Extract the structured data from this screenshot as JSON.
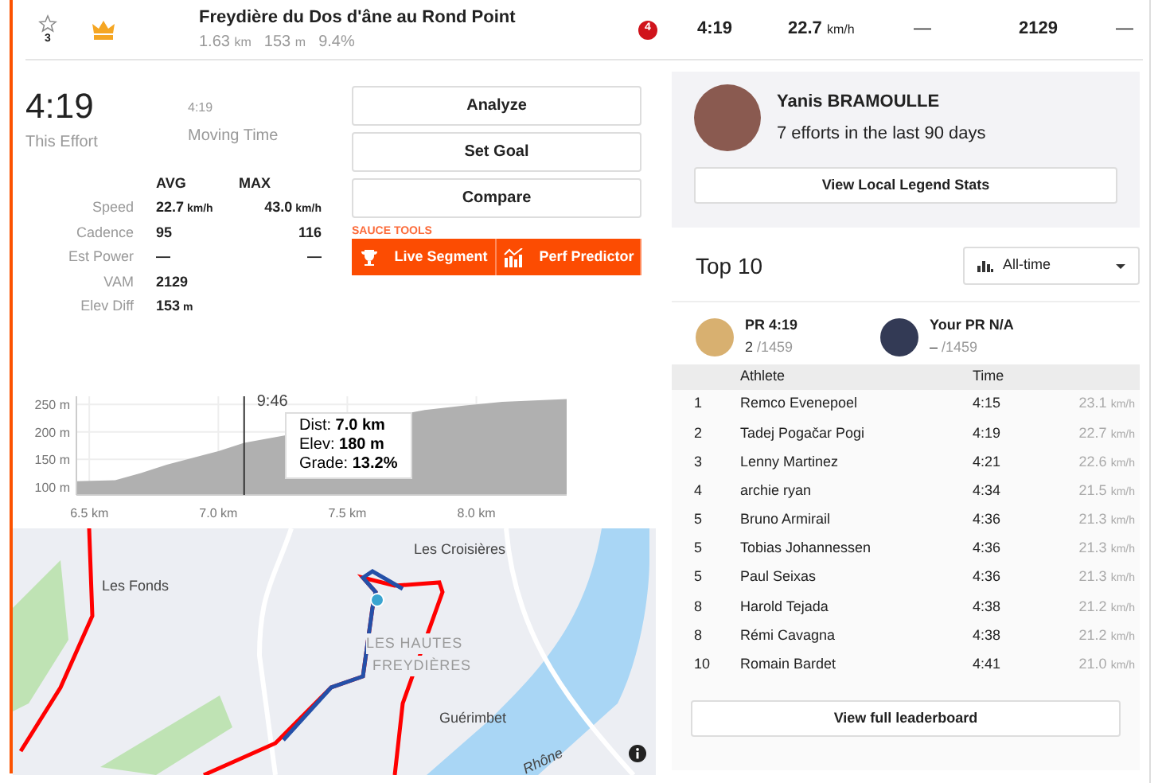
{
  "segment": {
    "star_count": "3",
    "name": "Freydière du Dos d'âne au Rond Point",
    "distance": "1.63",
    "distance_unit": "km",
    "elevation": "153",
    "elevation_unit": "m",
    "grade": "9.4%",
    "badge": "4",
    "time": "4:19",
    "speed": "22.7",
    "speed_unit": "km/h",
    "power": "—",
    "vam": "2129",
    "last": "—"
  },
  "effort": {
    "time": "4:19",
    "time_label": "This Effort",
    "moving_time": "4:19",
    "moving_label": "Moving Time"
  },
  "stats": {
    "columns": [
      "AVG",
      "MAX"
    ],
    "rows": [
      {
        "label": "Speed",
        "avg": "22.7",
        "avg_unit": "km/h",
        "max": "43.0",
        "max_unit": "km/h"
      },
      {
        "label": "Cadence",
        "avg": "95",
        "max": "116"
      },
      {
        "label": "Est Power",
        "avg": "—",
        "max": "—"
      },
      {
        "label": "VAM",
        "avg": "2129"
      },
      {
        "label": "Elev Diff",
        "avg": "153",
        "avg_unit": "m"
      }
    ]
  },
  "actions": [
    "Analyze",
    "Set Goal",
    "Compare"
  ],
  "sauce_tools": {
    "title": "SAUCE TOOLS",
    "buttons": [
      {
        "label": "Live Segment",
        "kind": "trophy"
      },
      {
        "label": "Perf Predictor",
        "kind": "chart"
      }
    ]
  },
  "elevation": {
    "chart_data": {
      "type": "area",
      "grid": true,
      "x": [
        6.45,
        6.6,
        6.7,
        6.8,
        7.0,
        7.1,
        7.8,
        7.95,
        8.1,
        8.35
      ],
      "series": [
        {
          "color": "#b0b0b0",
          "values": [
            110,
            112,
            125,
            140,
            165,
            180,
            240,
            248,
            255,
            260
          ]
        }
      ],
      "ref_lines": [
        {
          "axis": "x",
          "value": 7.1
        }
      ],
      "xlim": [
        6.45,
        8.35
      ],
      "ylim": [
        85,
        265
      ],
      "xticks": [
        {
          "value": 6.5,
          "label": "6.5 km"
        },
        {
          "value": 7.0,
          "label": "7.0 km"
        },
        {
          "value": 7.5,
          "label": "7.5 km"
        },
        {
          "value": 8.0,
          "label": "8.0 km"
        }
      ],
      "yticks": [
        {
          "value": 100,
          "label": "100 m"
        },
        {
          "value": 150,
          "label": "150 m"
        },
        {
          "value": 200,
          "label": "200 m"
        },
        {
          "value": 250,
          "label": "250 m"
        }
      ]
    },
    "cursor_time": "9:46",
    "tooltip": [
      {
        "label": "Dist:",
        "value": "7.0 km"
      },
      {
        "label": "Elev:",
        "value": "180 m"
      },
      {
        "label": "Grade:",
        "value": "13.2%"
      }
    ]
  },
  "map": {
    "labels": [
      "Les Fonds",
      "Les Croisières",
      "LES HAUTES",
      "FREYDIÈRES",
      "Guérimbet",
      "Rhône"
    ]
  },
  "local_legend": {
    "name": "Yanis BRAMOULLE",
    "efforts": "7 efforts in the last 90 days",
    "button": "View Local Legend Stats"
  },
  "leaderboard": {
    "title": "Top 10",
    "filter": "All-time",
    "prs": [
      {
        "label": "PR 4:19",
        "rank": "2",
        "total": "/1459"
      },
      {
        "label": "Your PR N/A",
        "rank": "–",
        "total": "/1459"
      }
    ],
    "columns": [
      "Athlete",
      "Time"
    ],
    "rows": [
      {
        "rank": "1",
        "name": "Remco Evenepoel",
        "time": "4:15",
        "speed": "23.1",
        "unit": "km/h"
      },
      {
        "rank": "2",
        "name": "Tadej Pogačar Pogi",
        "time": "4:19",
        "speed": "22.7",
        "unit": "km/h"
      },
      {
        "rank": "3",
        "name": "Lenny Martinez",
        "time": "4:21",
        "speed": "22.6",
        "unit": "km/h"
      },
      {
        "rank": "4",
        "name": "archie ryan",
        "time": "4:34",
        "speed": "21.5",
        "unit": "km/h"
      },
      {
        "rank": "5",
        "name": "Bruno Armirail",
        "time": "4:36",
        "speed": "21.3",
        "unit": "km/h"
      },
      {
        "rank": "5",
        "name": "Tobias Johannessen",
        "time": "4:36",
        "speed": "21.3",
        "unit": "km/h"
      },
      {
        "rank": "5",
        "name": "Paul Seixas",
        "time": "4:36",
        "speed": "21.3",
        "unit": "km/h"
      },
      {
        "rank": "8",
        "name": "Harold Tejada",
        "time": "4:38",
        "speed": "21.2",
        "unit": "km/h"
      },
      {
        "rank": "8",
        "name": "Rémi Cavagna",
        "time": "4:38",
        "speed": "21.2",
        "unit": "km/h"
      },
      {
        "rank": "10",
        "name": "Romain Bardet",
        "time": "4:41",
        "speed": "21.0",
        "unit": "km/h"
      }
    ],
    "button": "View full leaderboard"
  }
}
